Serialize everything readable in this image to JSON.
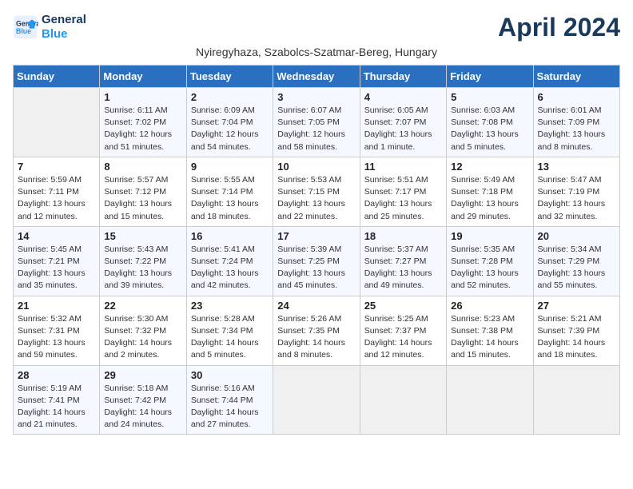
{
  "header": {
    "logo_line1": "General",
    "logo_line2": "Blue",
    "title": "April 2024",
    "subtitle": "Nyiregyhaza, Szabolcs-Szatmar-Bereg, Hungary"
  },
  "days_of_week": [
    "Sunday",
    "Monday",
    "Tuesday",
    "Wednesday",
    "Thursday",
    "Friday",
    "Saturday"
  ],
  "weeks": [
    [
      {
        "day": "",
        "content": ""
      },
      {
        "day": "1",
        "content": "Sunrise: 6:11 AM\nSunset: 7:02 PM\nDaylight: 12 hours\nand 51 minutes."
      },
      {
        "day": "2",
        "content": "Sunrise: 6:09 AM\nSunset: 7:04 PM\nDaylight: 12 hours\nand 54 minutes."
      },
      {
        "day": "3",
        "content": "Sunrise: 6:07 AM\nSunset: 7:05 PM\nDaylight: 12 hours\nand 58 minutes."
      },
      {
        "day": "4",
        "content": "Sunrise: 6:05 AM\nSunset: 7:07 PM\nDaylight: 13 hours\nand 1 minute."
      },
      {
        "day": "5",
        "content": "Sunrise: 6:03 AM\nSunset: 7:08 PM\nDaylight: 13 hours\nand 5 minutes."
      },
      {
        "day": "6",
        "content": "Sunrise: 6:01 AM\nSunset: 7:09 PM\nDaylight: 13 hours\nand 8 minutes."
      }
    ],
    [
      {
        "day": "7",
        "content": "Sunrise: 5:59 AM\nSunset: 7:11 PM\nDaylight: 13 hours\nand 12 minutes."
      },
      {
        "day": "8",
        "content": "Sunrise: 5:57 AM\nSunset: 7:12 PM\nDaylight: 13 hours\nand 15 minutes."
      },
      {
        "day": "9",
        "content": "Sunrise: 5:55 AM\nSunset: 7:14 PM\nDaylight: 13 hours\nand 18 minutes."
      },
      {
        "day": "10",
        "content": "Sunrise: 5:53 AM\nSunset: 7:15 PM\nDaylight: 13 hours\nand 22 minutes."
      },
      {
        "day": "11",
        "content": "Sunrise: 5:51 AM\nSunset: 7:17 PM\nDaylight: 13 hours\nand 25 minutes."
      },
      {
        "day": "12",
        "content": "Sunrise: 5:49 AM\nSunset: 7:18 PM\nDaylight: 13 hours\nand 29 minutes."
      },
      {
        "day": "13",
        "content": "Sunrise: 5:47 AM\nSunset: 7:19 PM\nDaylight: 13 hours\nand 32 minutes."
      }
    ],
    [
      {
        "day": "14",
        "content": "Sunrise: 5:45 AM\nSunset: 7:21 PM\nDaylight: 13 hours\nand 35 minutes."
      },
      {
        "day": "15",
        "content": "Sunrise: 5:43 AM\nSunset: 7:22 PM\nDaylight: 13 hours\nand 39 minutes."
      },
      {
        "day": "16",
        "content": "Sunrise: 5:41 AM\nSunset: 7:24 PM\nDaylight: 13 hours\nand 42 minutes."
      },
      {
        "day": "17",
        "content": "Sunrise: 5:39 AM\nSunset: 7:25 PM\nDaylight: 13 hours\nand 45 minutes."
      },
      {
        "day": "18",
        "content": "Sunrise: 5:37 AM\nSunset: 7:27 PM\nDaylight: 13 hours\nand 49 minutes."
      },
      {
        "day": "19",
        "content": "Sunrise: 5:35 AM\nSunset: 7:28 PM\nDaylight: 13 hours\nand 52 minutes."
      },
      {
        "day": "20",
        "content": "Sunrise: 5:34 AM\nSunset: 7:29 PM\nDaylight: 13 hours\nand 55 minutes."
      }
    ],
    [
      {
        "day": "21",
        "content": "Sunrise: 5:32 AM\nSunset: 7:31 PM\nDaylight: 13 hours\nand 59 minutes."
      },
      {
        "day": "22",
        "content": "Sunrise: 5:30 AM\nSunset: 7:32 PM\nDaylight: 14 hours\nand 2 minutes."
      },
      {
        "day": "23",
        "content": "Sunrise: 5:28 AM\nSunset: 7:34 PM\nDaylight: 14 hours\nand 5 minutes."
      },
      {
        "day": "24",
        "content": "Sunrise: 5:26 AM\nSunset: 7:35 PM\nDaylight: 14 hours\nand 8 minutes."
      },
      {
        "day": "25",
        "content": "Sunrise: 5:25 AM\nSunset: 7:37 PM\nDaylight: 14 hours\nand 12 minutes."
      },
      {
        "day": "26",
        "content": "Sunrise: 5:23 AM\nSunset: 7:38 PM\nDaylight: 14 hours\nand 15 minutes."
      },
      {
        "day": "27",
        "content": "Sunrise: 5:21 AM\nSunset: 7:39 PM\nDaylight: 14 hours\nand 18 minutes."
      }
    ],
    [
      {
        "day": "28",
        "content": "Sunrise: 5:19 AM\nSunset: 7:41 PM\nDaylight: 14 hours\nand 21 minutes."
      },
      {
        "day": "29",
        "content": "Sunrise: 5:18 AM\nSunset: 7:42 PM\nDaylight: 14 hours\nand 24 minutes."
      },
      {
        "day": "30",
        "content": "Sunrise: 5:16 AM\nSunset: 7:44 PM\nDaylight: 14 hours\nand 27 minutes."
      },
      {
        "day": "",
        "content": ""
      },
      {
        "day": "",
        "content": ""
      },
      {
        "day": "",
        "content": ""
      },
      {
        "day": "",
        "content": ""
      }
    ]
  ]
}
